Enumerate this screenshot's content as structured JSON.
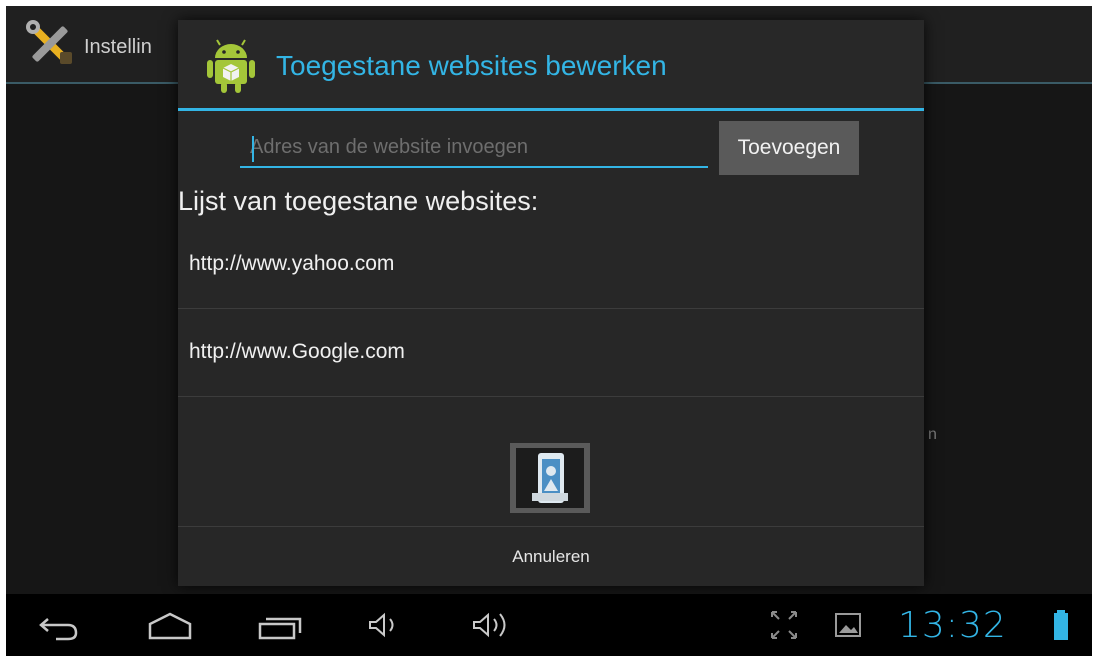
{
  "background_app": {
    "title": "Instellin",
    "side_fragment": "n"
  },
  "dialog": {
    "title": "Toegestane websites bewerken",
    "input": {
      "value": "",
      "placeholder": "Adres van de website invoegen"
    },
    "add_label": "Toevoegen",
    "list_heading": "Lijst van toegestane websites:",
    "sites": [
      "http://www.yahoo.com",
      "http://www.Google.com"
    ],
    "cancel_label": "Annuleren"
  },
  "system_bar": {
    "time": "13:32",
    "icons": [
      "back-icon",
      "home-icon",
      "recent-apps-icon",
      "volume-down-icon",
      "volume-up-icon",
      "fullscreen-icon",
      "gallery-icon",
      "battery-icon"
    ]
  },
  "colors": {
    "accent": "#33b5e5",
    "dialog_bg": "#272727",
    "button_bg": "#5a5a5a",
    "android_green": "#a4c639"
  }
}
